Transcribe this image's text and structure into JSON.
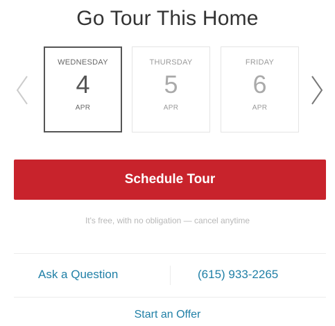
{
  "header": {
    "title": "Go Tour This Home"
  },
  "dates": [
    {
      "day_of_week": "WEDNESDAY",
      "day": "4",
      "month": "APR",
      "selected": true
    },
    {
      "day_of_week": "THURSDAY",
      "day": "5",
      "month": "APR",
      "selected": false
    },
    {
      "day_of_week": "FRIDAY",
      "day": "6",
      "month": "APR",
      "selected": false
    }
  ],
  "icons": {
    "prev": "chevron-left-icon",
    "next": "chevron-right-icon"
  },
  "cta": {
    "schedule_label": "Schedule Tour",
    "disclaimer": "It's free, with no obligation — cancel anytime"
  },
  "contact": {
    "ask_label": "Ask a Question",
    "phone": "(615) 933-2265",
    "offer_label": "Start an Offer"
  },
  "colors": {
    "accent_red": "#c8232c",
    "link_blue": "#1f7fa6",
    "selected_border": "#555555"
  }
}
